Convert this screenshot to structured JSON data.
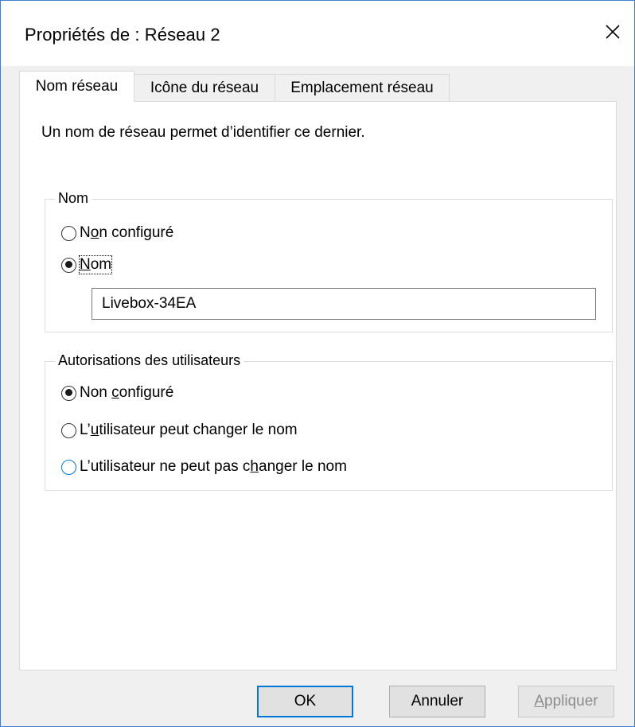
{
  "window": {
    "title": "Propriétés de : Réseau  2",
    "close_icon": "close-icon"
  },
  "tabs": [
    {
      "label": "Nom réseau",
      "active": true
    },
    {
      "label": "Icône du réseau",
      "active": false
    },
    {
      "label": "Emplacement réseau",
      "active": false
    }
  ],
  "panel": {
    "description": "Un nom de réseau permet d’identifier ce dernier."
  },
  "name_group": {
    "legend": "Nom",
    "option_not_configured": {
      "pre": "N",
      "u": "o",
      "post": "n configuré",
      "checked": false
    },
    "option_name": {
      "pre": "",
      "u": "N",
      "post": "om",
      "checked": true
    },
    "name_value": "Livebox-34EA"
  },
  "permissions_group": {
    "legend": "Autorisations des utilisateurs",
    "option_not_configured": {
      "pre": "Non ",
      "u": "c",
      "post": "onfiguré",
      "checked": true
    },
    "option_can_change": {
      "pre": "L’",
      "u": "u",
      "post": "tilisateur peut changer le nom",
      "checked": false
    },
    "option_cannot_change": {
      "pre": "L’utilisateur ne peut pas c",
      "u": "h",
      "post": "anger le nom",
      "checked": false
    }
  },
  "buttons": {
    "ok": "OK",
    "cancel": "Annuler",
    "apply_pre": "",
    "apply_u": "A",
    "apply_post": "ppliquer"
  },
  "colors": {
    "accent": "#0078d7",
    "window_border": "#3f7fcf",
    "dialog_bg": "#f0f0f0"
  }
}
